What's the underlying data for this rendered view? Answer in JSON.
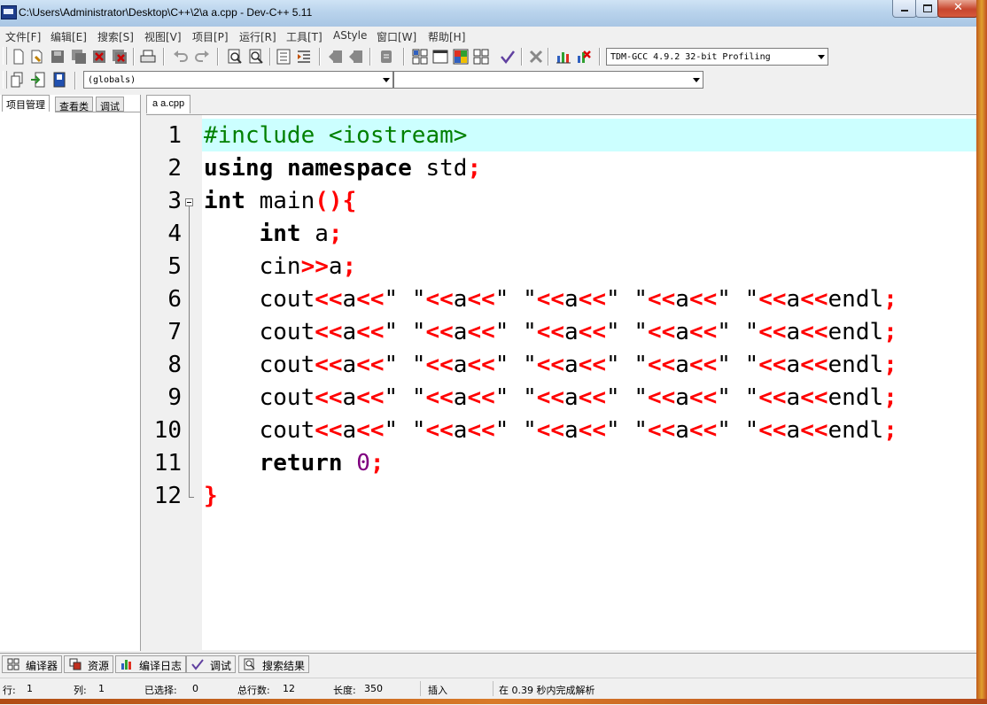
{
  "window": {
    "title": "C:\\Users\\Administrator\\Desktop\\C++\\2\\a a.cpp - Dev-C++ 5.11",
    "controls": {
      "minimize": "minimize-icon",
      "maximize": "maximize-icon",
      "close": "close-icon"
    }
  },
  "menu": [
    "文件[F]",
    "编辑[E]",
    "搜索[S]",
    "视图[V]",
    "项目[P]",
    "运行[R]",
    "工具[T]",
    "AStyle",
    "窗口[W]",
    "帮助[H]"
  ],
  "toolbar": {
    "compiler_select": "TDM-GCC 4.9.2 32-bit Profiling",
    "scope_select": "(globals)",
    "function_select": ""
  },
  "left_panel": {
    "tabs": [
      "项目管理",
      "查看类",
      "调试"
    ]
  },
  "editor": {
    "tab": "a a.cpp",
    "line_numbers": [
      "1",
      "2",
      "3",
      "4",
      "5",
      "6",
      "7",
      "8",
      "9",
      "10",
      "11",
      "12"
    ],
    "lines": [
      "#include <iostream>",
      "using namespace std;",
      "int main(){",
      "    int a;",
      "    cin>>a;",
      "    cout<<a<<\" \"<<a<<\" \"<<a<<\" \"<<a<<\" \"<<a<<endl;",
      "    cout<<a<<\" \"<<a<<\" \"<<a<<\" \"<<a<<\" \"<<a<<endl;",
      "    cout<<a<<\" \"<<a<<\" \"<<a<<\" \"<<a<<\" \"<<a<<endl;",
      "    cout<<a<<\" \"<<a<<\" \"<<a<<\" \"<<a<<\" \"<<a<<endl;",
      "    cout<<a<<\" \"<<a<<\" \"<<a<<\" \"<<a<<\" \"<<a<<endl;",
      "    return 0;",
      "}"
    ],
    "highlight_color": "#ccffff"
  },
  "bottom_tabs": [
    "编译器",
    "资源",
    "编译日志",
    "调试",
    "搜索结果"
  ],
  "status": {
    "row_label": "行:",
    "row": "1",
    "col_label": "列:",
    "col": "1",
    "sel_label": "已选择:",
    "sel": "0",
    "total_label": "总行数:",
    "total": "12",
    "len_label": "长度:",
    "len": "350",
    "mode": "插入",
    "parse": "在 0.39 秒内完成解析"
  },
  "colors": {
    "keyword": "#000000",
    "preprocessor": "#008000",
    "symbol": "#ff0000",
    "number": "#800080"
  }
}
